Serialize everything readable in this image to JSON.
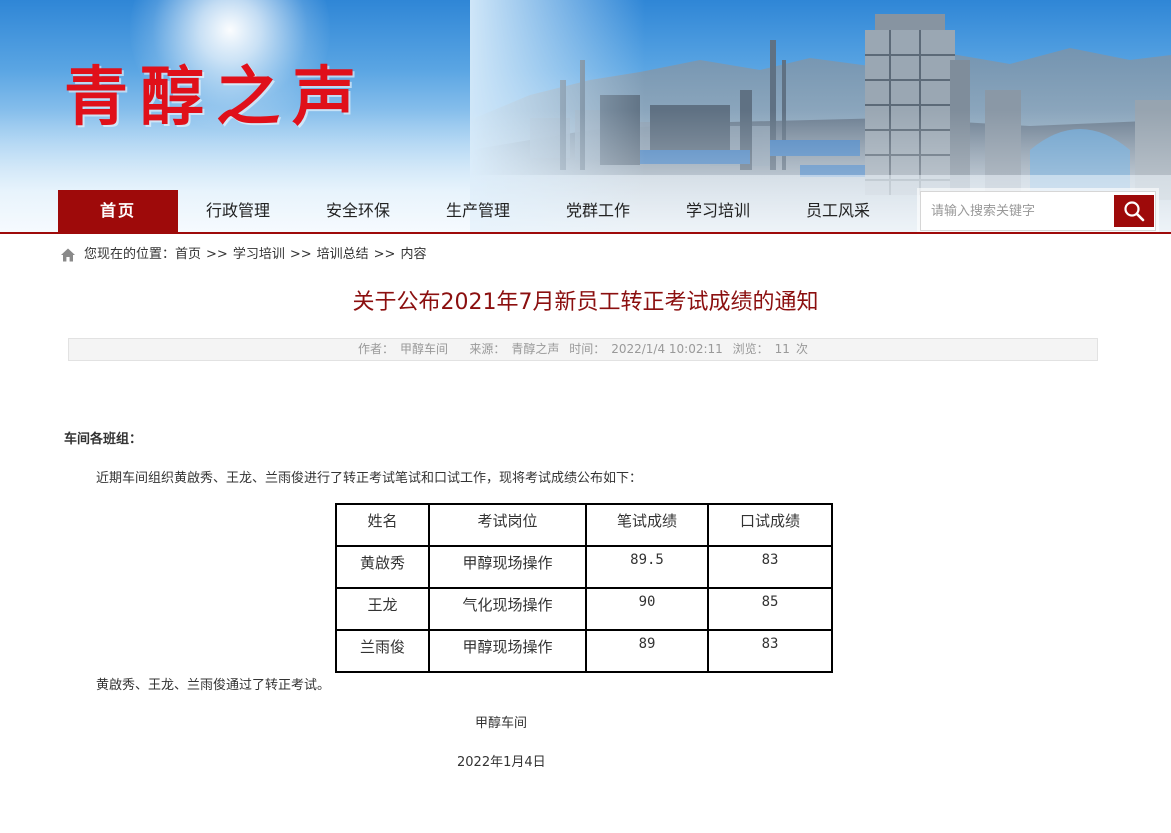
{
  "header": {
    "logo_text": "青醇之声"
  },
  "nav": {
    "items": [
      {
        "label": "首页",
        "active": true
      },
      {
        "label": "行政管理",
        "active": false
      },
      {
        "label": "安全环保",
        "active": false
      },
      {
        "label": "生产管理",
        "active": false
      },
      {
        "label": "党群工作",
        "active": false
      },
      {
        "label": "学习培训",
        "active": false
      },
      {
        "label": "员工风采",
        "active": false
      }
    ]
  },
  "search": {
    "placeholder": "请输入搜索关键字",
    "icon": "search-icon"
  },
  "breadcrumb": {
    "prefix": "您现在的位置：",
    "items": [
      "首页",
      "学习培训",
      "培训总结"
    ],
    "separator": ">>",
    "current": "内容"
  },
  "article": {
    "title": "关于公布2021年7月新员工转正考试成绩的通知",
    "meta": {
      "author_label": "作者：",
      "author": "甲醇车间",
      "source_label": "来源：",
      "source": "青醇之声",
      "time_label": "时间：",
      "time": "2022/1/4 10:02:11",
      "views_label": "浏览：",
      "views": "11",
      "views_unit": "次"
    },
    "greeting": "车间各班组：",
    "intro": "近期车间组织黄啟秀、王龙、兰雨俊进行了转正考试笔试和口试工作，现将考试成绩公布如下：",
    "table": {
      "headers": [
        "姓名",
        "考试岗位",
        "笔试成绩",
        "口试成绩"
      ],
      "rows": [
        [
          "黄啟秀",
          "甲醇现场操作",
          "89.5",
          "83"
        ],
        [
          "王龙",
          "气化现场操作",
          "90",
          "85"
        ],
        [
          "兰雨俊",
          "甲醇现场操作",
          "89",
          "83"
        ]
      ]
    },
    "result": "黄啟秀、王龙、兰雨俊通过了转正考试。",
    "signature": "甲醇车间",
    "date": "2022年1月4日"
  },
  "colors": {
    "brand_red": "#9e0a0a",
    "logo_red": "#e0101a",
    "title_red": "#8b0f0f"
  }
}
